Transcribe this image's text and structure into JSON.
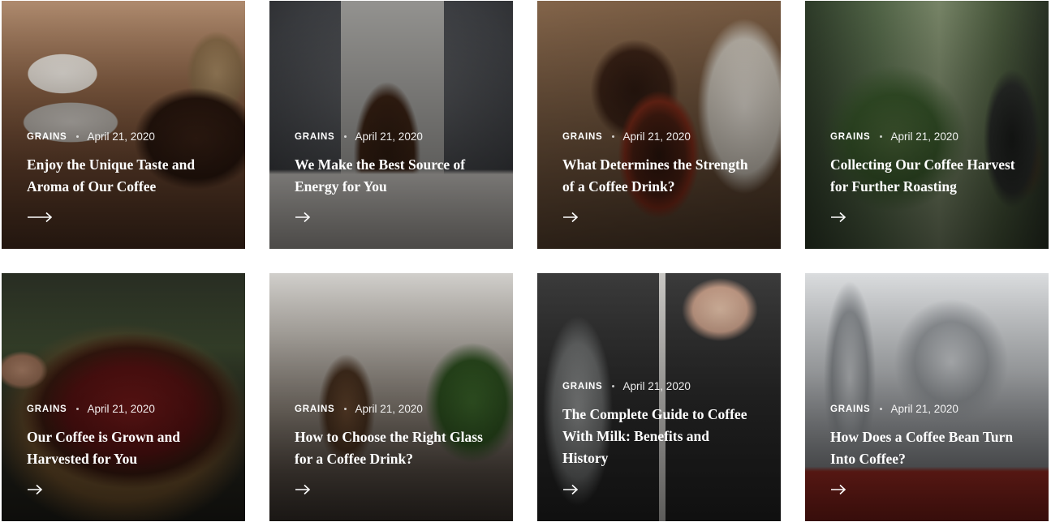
{
  "posts": [
    {
      "category": "GRAINS",
      "date": "April 21, 2020",
      "title": "Enjoy the Unique Taste and Aroma of Our Coffee"
    },
    {
      "category": "GRAINS",
      "date": "April 21, 2020",
      "title": "We Make the Best Source of Energy for You"
    },
    {
      "category": "GRAINS",
      "date": "April 21, 2020",
      "title": "What Determines the Strength of a Coffee Drink?"
    },
    {
      "category": "GRAINS",
      "date": "April 21, 2020",
      "title": "Collecting Our Coffee Harvest for Further Roasting"
    },
    {
      "category": "GRAINS",
      "date": "April 21, 2020",
      "title": "Our Coffee is Grown and Harvested for You"
    },
    {
      "category": "GRAINS",
      "date": "April 21, 2020",
      "title": "How to Choose the Right Glass for a Coffee Drink?"
    },
    {
      "category": "GRAINS",
      "date": "April 21, 2020",
      "title": "The Complete Guide to Coffee With Milk: Benefits and History"
    },
    {
      "category": "GRAINS",
      "date": "April 21, 2020",
      "title": "How Does a Coffee Bean Turn Into Coffee?"
    }
  ],
  "icons": {
    "arrow": "arrow-right-icon"
  },
  "colors": {
    "text": "#ffffff",
    "page_background": "#ffffff"
  }
}
